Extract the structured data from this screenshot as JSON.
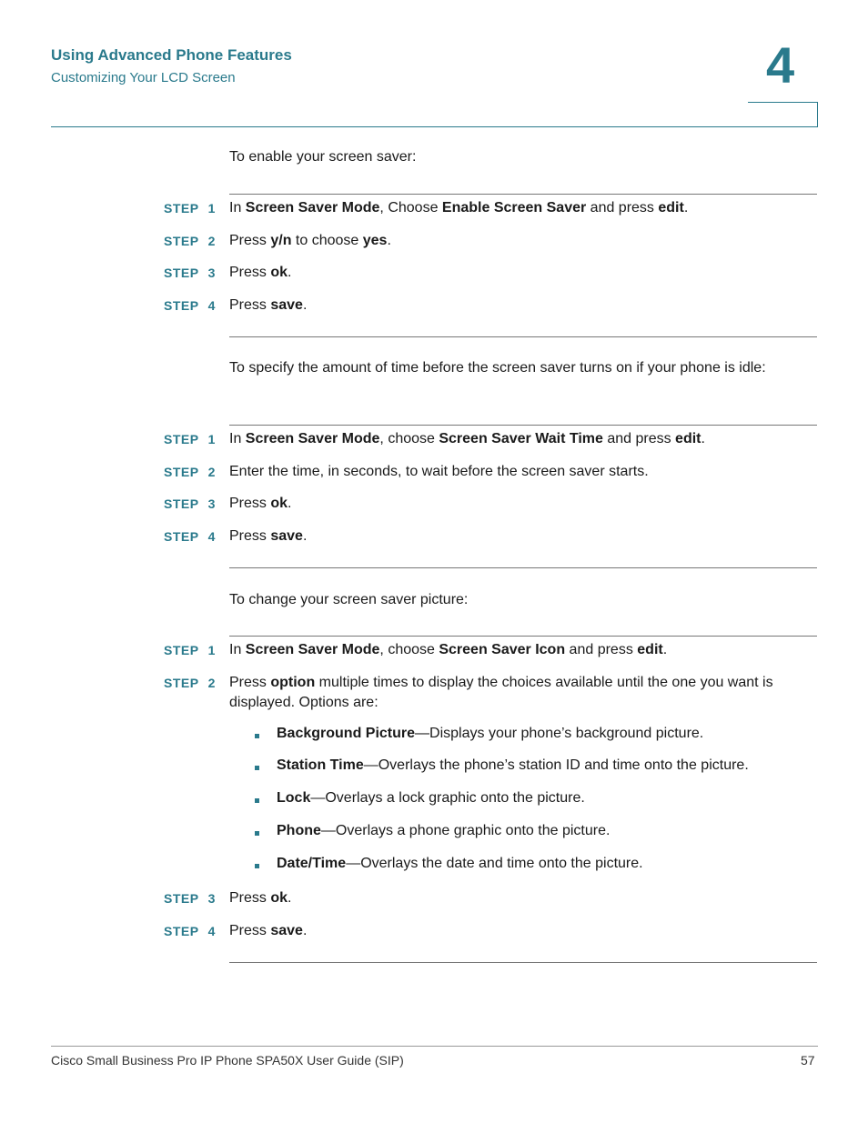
{
  "header": {
    "chapter_title": "Using Advanced Phone Features",
    "section_title": "Customizing Your LCD Screen",
    "chapter_number": "4"
  },
  "sections": [
    {
      "intro": "To enable your screen saver:",
      "steps": [
        {
          "label": "STEP",
          "num": "1",
          "parts": [
            [
              "",
              "In "
            ],
            [
              "b",
              "Screen Saver Mode"
            ],
            [
              "",
              ", Choose "
            ],
            [
              "b",
              "Enable Screen Saver"
            ],
            [
              "",
              " and press "
            ],
            [
              "b",
              "edit"
            ],
            [
              "",
              "."
            ]
          ]
        },
        {
          "label": "STEP",
          "num": "2",
          "parts": [
            [
              "",
              "Press "
            ],
            [
              "b",
              "y/n"
            ],
            [
              "",
              " to choose "
            ],
            [
              "b",
              "yes"
            ],
            [
              "",
              "."
            ]
          ]
        },
        {
          "label": "STEP",
          "num": "3",
          "parts": [
            [
              "",
              "Press "
            ],
            [
              "b",
              "ok"
            ],
            [
              "",
              "."
            ]
          ]
        },
        {
          "label": "STEP",
          "num": "4",
          "parts": [
            [
              "",
              "Press "
            ],
            [
              "b",
              "save"
            ],
            [
              "",
              "."
            ]
          ]
        }
      ]
    },
    {
      "intro": "To specify the amount of time before the screen saver turns on if your phone is idle:",
      "steps": [
        {
          "label": "STEP",
          "num": "1",
          "parts": [
            [
              "",
              "In "
            ],
            [
              "b",
              "Screen Saver Mode"
            ],
            [
              "",
              ", choose "
            ],
            [
              "b",
              "Screen Saver Wait Time"
            ],
            [
              "",
              " and press "
            ],
            [
              "b",
              "edit"
            ],
            [
              "",
              "."
            ]
          ]
        },
        {
          "label": "STEP",
          "num": "2",
          "parts": [
            [
              "",
              "Enter the time, in seconds, to wait before the screen saver starts."
            ]
          ]
        },
        {
          "label": "STEP",
          "num": "3",
          "parts": [
            [
              "",
              "Press "
            ],
            [
              "b",
              "ok"
            ],
            [
              "",
              "."
            ]
          ]
        },
        {
          "label": "STEP",
          "num": "4",
          "parts": [
            [
              "",
              "Press "
            ],
            [
              "b",
              "save"
            ],
            [
              "",
              "."
            ]
          ]
        }
      ]
    },
    {
      "intro": "To change your screen saver picture:",
      "steps": [
        {
          "label": "STEP",
          "num": "1",
          "parts": [
            [
              "",
              "In "
            ],
            [
              "b",
              "Screen Saver Mode"
            ],
            [
              "",
              ", choose "
            ],
            [
              "b",
              "Screen Saver Icon"
            ],
            [
              "",
              " and press "
            ],
            [
              "b",
              "edit"
            ],
            [
              "",
              "."
            ]
          ]
        },
        {
          "label": "STEP",
          "num": "2",
          "parts": [
            [
              "",
              "Press "
            ],
            [
              "b",
              "option"
            ],
            [
              "",
              " multiple times to display the choices available until the one you want is displayed. Options are:"
            ]
          ]
        },
        {
          "label": "STEP",
          "num": "3",
          "parts": [
            [
              "",
              "Press "
            ],
            [
              "b",
              "ok"
            ],
            [
              "",
              "."
            ]
          ]
        },
        {
          "label": "STEP",
          "num": "4",
          "parts": [
            [
              "",
              "Press "
            ],
            [
              "b",
              "save"
            ],
            [
              "",
              "."
            ]
          ]
        }
      ],
      "options": [
        {
          "term": "Background Picture",
          "desc": "—Displays your phone’s background picture."
        },
        {
          "term": "Station Time",
          "desc": "—Overlays the phone’s station ID and time onto the picture."
        },
        {
          "term": "Lock",
          "desc": "—Overlays a lock graphic onto the picture."
        },
        {
          "term": "Phone",
          "desc": "—Overlays a phone graphic onto the picture."
        },
        {
          "term": "Date/Time",
          "desc": "—Overlays the date and time onto the picture."
        }
      ]
    }
  ],
  "footer": {
    "guide_title": "Cisco Small Business Pro IP Phone SPA50X User Guide (SIP)",
    "page_number": "57"
  }
}
